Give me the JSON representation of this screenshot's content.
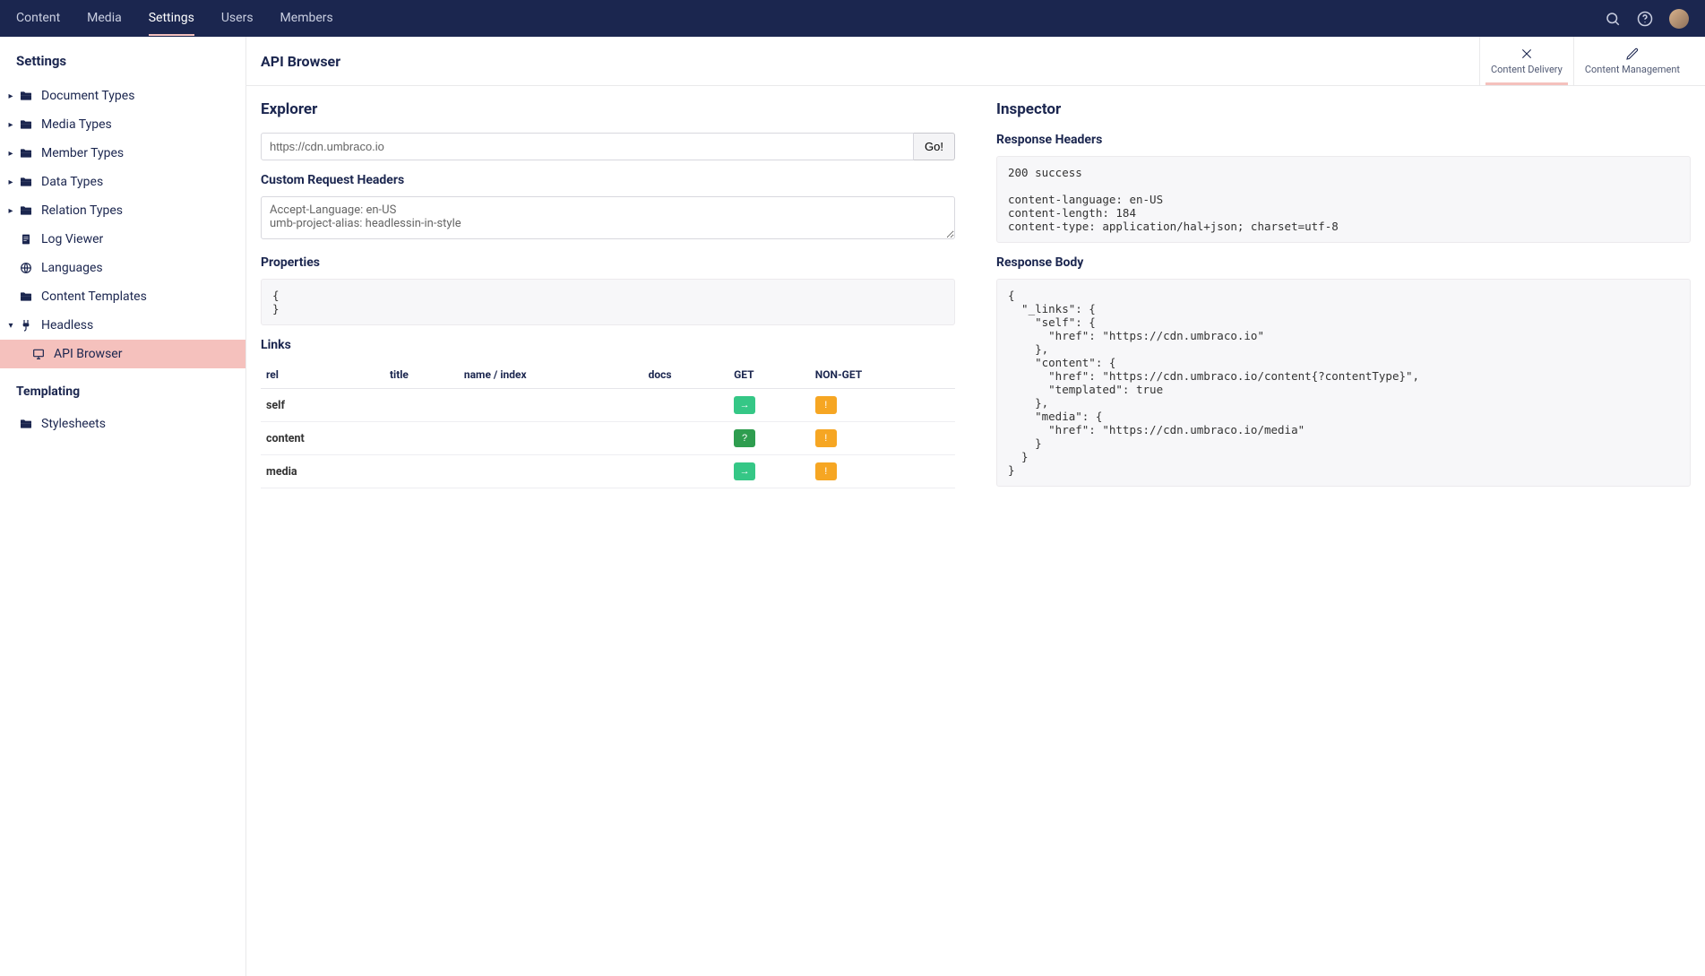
{
  "topnav": {
    "items": [
      "Content",
      "Media",
      "Settings",
      "Users",
      "Members"
    ],
    "active_index": 2
  },
  "sidebar": {
    "section_title": "Settings",
    "tree": [
      {
        "label": "Document Types",
        "icon": "folder",
        "caret": "right"
      },
      {
        "label": "Media Types",
        "icon": "folder",
        "caret": "right"
      },
      {
        "label": "Member Types",
        "icon": "folder",
        "caret": "right"
      },
      {
        "label": "Data Types",
        "icon": "folder",
        "caret": "right"
      },
      {
        "label": "Relation Types",
        "icon": "folder",
        "caret": "right"
      },
      {
        "label": "Log Viewer",
        "icon": "doc",
        "caret": ""
      },
      {
        "label": "Languages",
        "icon": "globe",
        "caret": ""
      },
      {
        "label": "Content Templates",
        "icon": "folder",
        "caret": ""
      },
      {
        "label": "Headless",
        "icon": "plug",
        "caret": "down"
      }
    ],
    "headless_child": {
      "label": "API Browser",
      "icon": "monitor",
      "selected": true
    },
    "templating_title": "Templating",
    "templating_items": [
      {
        "label": "Stylesheets",
        "icon": "folder"
      }
    ]
  },
  "page": {
    "title": "API Browser",
    "tabs": {
      "content_delivery": "Content Delivery",
      "content_management": "Content Management",
      "active": 0
    }
  },
  "explorer": {
    "title": "Explorer",
    "url_value": "https://cdn.umbraco.io",
    "go_label": "Go!",
    "headers_title": "Custom Request Headers",
    "headers_value": "Accept-Language: en-US\numb-project-alias: headlessin-in-style",
    "properties_title": "Properties",
    "properties_body": "{\n}",
    "links_title": "Links",
    "links_columns": {
      "rel": "rel",
      "title": "title",
      "name_index": "name / index",
      "docs": "docs",
      "get": "GET",
      "nonget": "NON-GET"
    },
    "links_rows": [
      {
        "rel": "self",
        "get_style": "green",
        "nonget": true
      },
      {
        "rel": "content",
        "get_style": "green-dark",
        "nonget": true
      },
      {
        "rel": "media",
        "get_style": "green",
        "nonget": true
      }
    ]
  },
  "inspector": {
    "title": "Inspector",
    "resp_headers_title": "Response Headers",
    "resp_headers_body": "200 success\n\ncontent-language: en-US\ncontent-length: 184\ncontent-type: application/hal+json; charset=utf-8",
    "resp_body_title": "Response Body",
    "resp_body_body": "{\n  \"_links\": {\n    \"self\": {\n      \"href\": \"https://cdn.umbraco.io\"\n    },\n    \"content\": {\n      \"href\": \"https://cdn.umbraco.io/content{?contentType}\",\n      \"templated\": true\n    },\n    \"media\": {\n      \"href\": \"https://cdn.umbraco.io/media\"\n    }\n  }\n}"
  }
}
